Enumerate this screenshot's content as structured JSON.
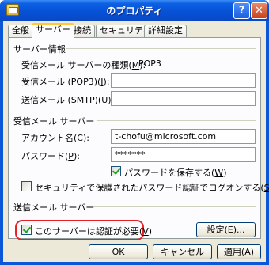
{
  "window": {
    "title": "のプロパティ",
    "help_label": "?",
    "close_label": "✕",
    "icon": "mail-account-icon"
  },
  "tabs": [
    {
      "label": "全般",
      "active": false
    },
    {
      "label": "サーバー",
      "active": true
    },
    {
      "label": "接続",
      "active": false
    },
    {
      "label": "セキュリティ",
      "active": false
    },
    {
      "label": "詳細設定",
      "active": false
    }
  ],
  "server_info": {
    "heading": "サーバー情報",
    "incoming_type": {
      "label": "受信メール サーバーの種類(",
      "key": "M",
      "suffix": "):",
      "value": "POP3"
    },
    "incoming": {
      "label": "受信メール (POP3)(",
      "key": "I",
      "suffix": "):",
      "value": ""
    },
    "outgoing": {
      "label": "送信メール (SMTP)(",
      "key": "U",
      "suffix": "):",
      "value": ""
    }
  },
  "incoming_server": {
    "heading": "受信メール サーバー",
    "account": {
      "label": "アカウント名(",
      "key": "C",
      "suffix": "):",
      "value": "t-chofu@microsoft.com"
    },
    "password": {
      "label": "パスワード(",
      "key": "P",
      "suffix": "):",
      "value": "*******"
    },
    "remember_password": {
      "label": "パスワードを保存する(",
      "key": "W",
      "suffix": ")",
      "checked": true
    },
    "spa": {
      "label": "セキュリティで保護されたパスワード認証でログオンする(",
      "key": "S",
      "suffix": ")",
      "checked": false
    }
  },
  "outgoing_server": {
    "heading": "送信メール サーバー",
    "requires_auth": {
      "label": "このサーバーは認証が必要(",
      "key": "V",
      "suffix": ")",
      "checked": true
    },
    "settings_button": "設定(E)..."
  },
  "footer": {
    "ok": "OK",
    "cancel": "キャンセル",
    "apply": {
      "label": "適用(",
      "key": "A",
      "suffix": ")"
    }
  },
  "colors": {
    "highlight": "#e8202a",
    "titlebar": "#0651d6",
    "dialog_bg": "#ece9d8"
  }
}
